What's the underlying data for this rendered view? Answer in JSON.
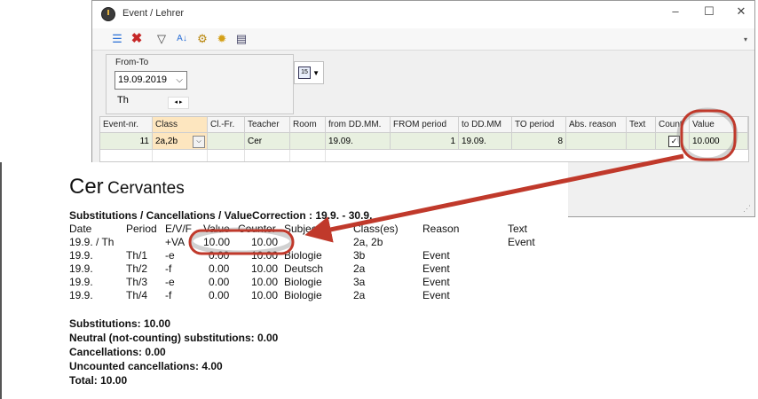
{
  "window": {
    "title": "Event / Lehrer",
    "controls": [
      "–",
      "☐",
      "✕"
    ]
  },
  "toolbar": {
    "icons": [
      "list-icon",
      "delete-icon",
      "filter-icon",
      "sort-icon",
      "settings-icon",
      "gear-icon",
      "book-icon"
    ]
  },
  "filter": {
    "group_label": "From-To",
    "date_value": "19.09.2019",
    "weekday": "Th",
    "spinner": "◂ ▸"
  },
  "grid": {
    "columns": [
      "Event-nr.",
      "Class",
      "Cl.-Fr.",
      "Teacher",
      "Room",
      "from DD.MM.",
      "FROM period",
      "to DD.MM",
      "TO period",
      "Abs. reason",
      "Text",
      "Count",
      "Value"
    ],
    "row": {
      "event_nr": "11",
      "class": "2a,2b",
      "cl_fr": "",
      "teacher": "Cer",
      "room": "",
      "from": "19.09.",
      "from_period": "1",
      "to": "19.09.",
      "to_period": "8",
      "abs_reason": "",
      "text": "",
      "count": "✓",
      "value": "10.000"
    }
  },
  "report": {
    "teacher_short": "Cer",
    "teacher_full": "Cervantes",
    "heading": "Substitutions / Cancellations / ValueCorrection : 19.9. - 30.9.",
    "columns": [
      "Date",
      "Period",
      "E/V/F",
      "Value",
      "Counter",
      "Subject",
      "Class(es)",
      "Reason",
      "Text"
    ],
    "rows": [
      {
        "date": "19.9. / Th",
        "period": "",
        "evf": "+VA",
        "value": "10.00",
        "counter": "10.00",
        "subject": "",
        "classes": "2a, 2b",
        "reason": "",
        "text": "Event"
      },
      {
        "date": "19.9.",
        "period": "Th/1",
        "evf": "-e",
        "value": "0.00",
        "counter": "10.00",
        "subject": "Biologie",
        "classes": "3b",
        "reason": "Event",
        "text": ""
      },
      {
        "date": "19.9.",
        "period": "Th/2",
        "evf": "-f",
        "value": "0.00",
        "counter": "10.00",
        "subject": "Deutsch",
        "classes": "2a",
        "reason": "Event",
        "text": ""
      },
      {
        "date": "19.9.",
        "period": "Th/3",
        "evf": "-e",
        "value": "0.00",
        "counter": "10.00",
        "subject": "Biologie",
        "classes": "3a",
        "reason": "Event",
        "text": ""
      },
      {
        "date": "19.9.",
        "period": "Th/4",
        "evf": "-f",
        "value": "0.00",
        "counter": "10.00",
        "subject": "Biologie",
        "classes": "2a",
        "reason": "Event",
        "text": ""
      }
    ],
    "summary": [
      "Substitutions: 10.00",
      "Neutral (not-counting) substitutions: 0.00",
      "Cancellations: 0.00",
      "Uncounted  cancellations: 4.00",
      "Total: 10.00"
    ]
  },
  "colors": {
    "highlight_ring": "#c0392b",
    "row_background": "#e8f0e0",
    "class_cell": "#fde6bf"
  }
}
